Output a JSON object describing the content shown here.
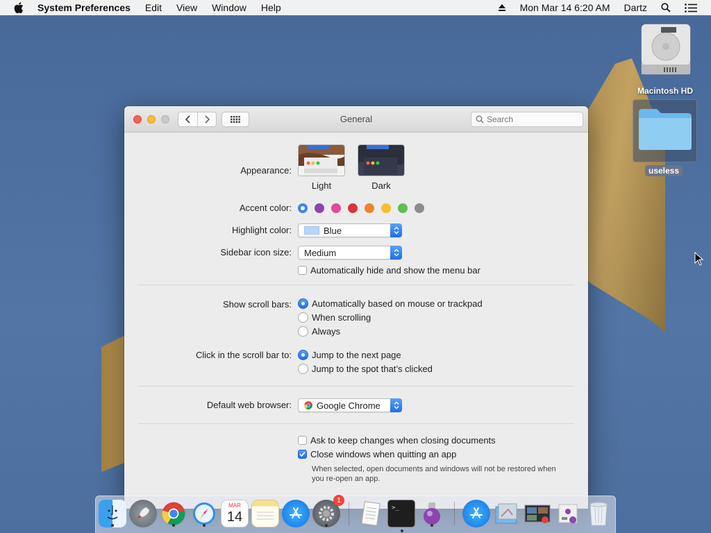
{
  "menubar": {
    "app_name": "System Preferences",
    "menus": [
      "Edit",
      "View",
      "Window",
      "Help"
    ],
    "datetime": "Mon Mar 14  6:20 AM",
    "user": "Dartz"
  },
  "desktop": {
    "disk_label": "Macintosh HD",
    "folder_label": "useless"
  },
  "window": {
    "title": "General",
    "search_placeholder": "Search"
  },
  "general": {
    "appearance_label": "Appearance:",
    "appearance_light": "Light",
    "appearance_dark": "Dark",
    "accent_label": "Accent color:",
    "accent_colors": [
      "#3b82f6",
      "#8e44ad",
      "#e04b9c",
      "#d9363e",
      "#f0832b",
      "#f6bf2b",
      "#5ec04f",
      "#8c8c8c"
    ],
    "accent_selected": 0,
    "highlight_label": "Highlight color:",
    "highlight_value": "Blue",
    "sidebar_label": "Sidebar icon size:",
    "sidebar_value": "Medium",
    "auto_hide_menu": "Automatically hide and show the menu bar",
    "auto_hide_menu_checked": false,
    "scroll_label": "Show scroll bars:",
    "scroll_opt_auto": "Automatically based on mouse or trackpad",
    "scroll_opt_scrolling": "When scrolling",
    "scroll_opt_always": "Always",
    "scroll_selected": "auto",
    "click_label": "Click in the scroll bar to:",
    "click_opt_next": "Jump to the next page",
    "click_opt_spot": "Jump to the spot that’s clicked",
    "click_selected": "next",
    "browser_label": "Default web browser:",
    "browser_value": "Google Chrome",
    "ask_keep": "Ask to keep changes when closing documents",
    "ask_keep_checked": false,
    "close_windows": "Close windows when quitting an app",
    "close_windows_checked": true,
    "close_windows_note": "When selected, open documents and windows will not be restored when you re-open an app."
  },
  "dock": {
    "items": [
      "finder",
      "launchpad",
      "chrome",
      "safari",
      "calendar",
      "notes",
      "app-store",
      "system-preferences",
      "textedit",
      "terminal",
      "screenshot",
      "app-store-2",
      "preview-folder",
      "photos",
      "utilities",
      "trash"
    ],
    "calendar_month": "MAR",
    "calendar_day": "14",
    "prefs_badge": "1"
  }
}
